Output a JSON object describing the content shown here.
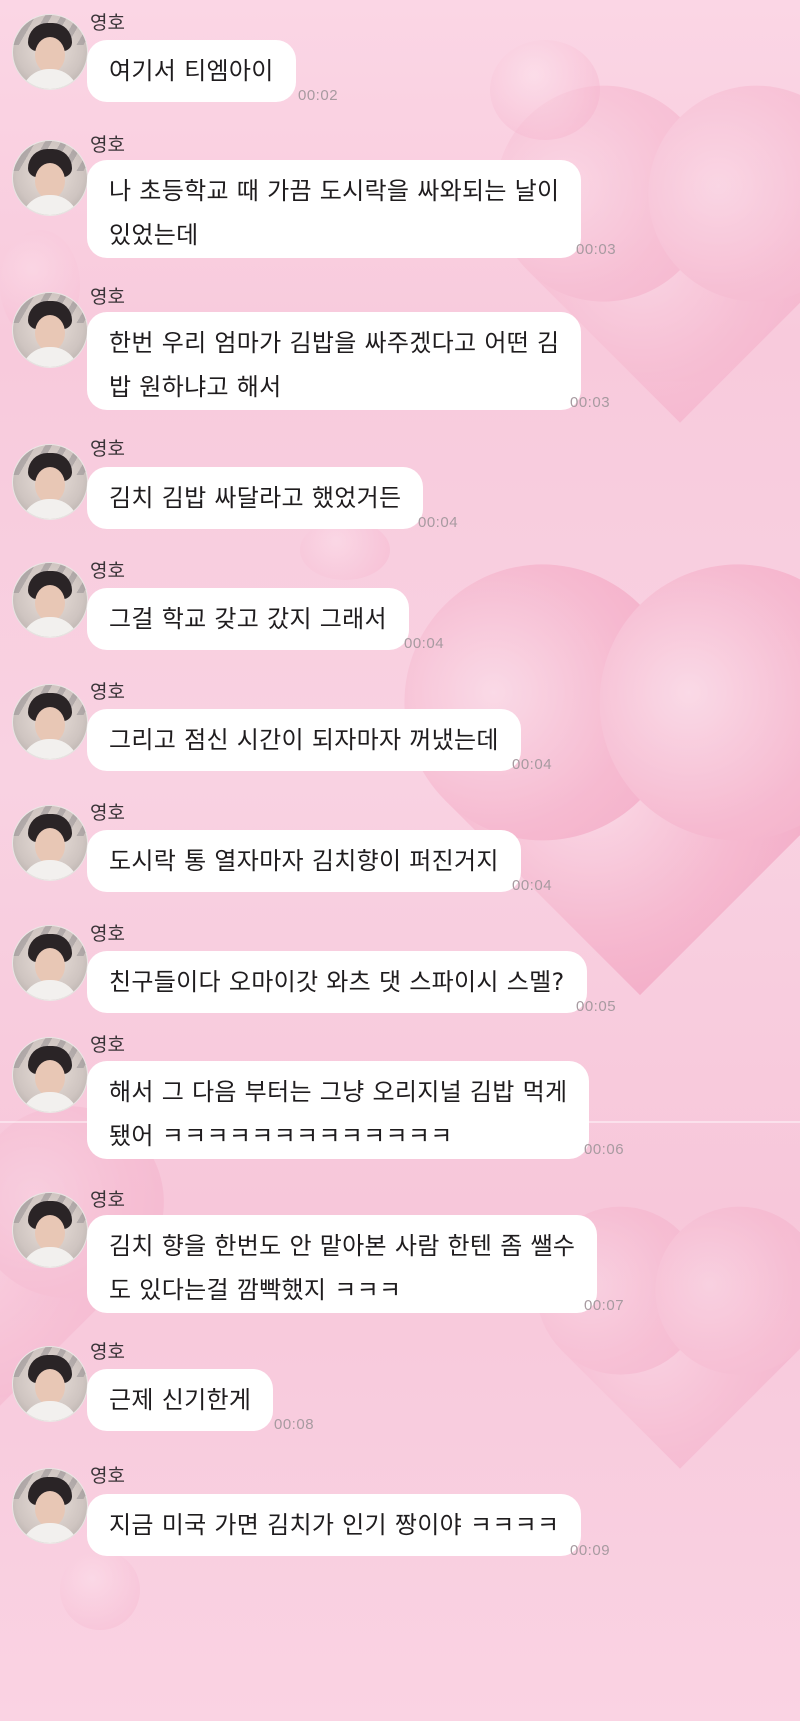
{
  "chat": {
    "messages": [
      {
        "sender": "영호",
        "lines": [
          "여기서 티엠아이"
        ],
        "time": "00:02"
      },
      {
        "sender": "영호",
        "lines": [
          "나 초등학교 때 가끔 도시락을 싸와되는 날이",
          "있었는데"
        ],
        "time": "00:03"
      },
      {
        "sender": "영호",
        "lines": [
          "한번 우리 엄마가 김밥을 싸주겠다고 어떤 김",
          "밥 원하냐고 해서"
        ],
        "time": "00:03"
      },
      {
        "sender": "영호",
        "lines": [
          "김치 김밥 싸달라고 했었거든"
        ],
        "time": "00:04"
      },
      {
        "sender": "영호",
        "lines": [
          "그걸 학교 갖고 갔지 그래서"
        ],
        "time": "00:04"
      },
      {
        "sender": "영호",
        "lines": [
          "그리고 점신 시간이 되자마자 꺼냈는데"
        ],
        "time": "00:04"
      },
      {
        "sender": "영호",
        "lines": [
          "도시락 통 열자마자 김치향이 퍼진거지"
        ],
        "time": "00:04"
      },
      {
        "sender": "영호",
        "lines": [
          "친구들이다 오마이갓 와츠 댓 스파이시 스멜?"
        ],
        "time": "00:05"
      },
      {
        "sender": "영호",
        "lines": [
          "해서 그 다음 부터는 그냥 오리지널 김밥 먹게",
          "됐어 ㅋㅋㅋㅋㅋㅋㅋㅋㅋㅋㅋㅋㅋ"
        ],
        "time": "00:06"
      },
      {
        "sender": "영호",
        "lines": [
          "김치 향을 한번도 안 맡아본 사람 한텐 좀 쌜수",
          "도 있다는걸 깜빡했지 ㅋㅋㅋ"
        ],
        "time": "00:07"
      },
      {
        "sender": "영호",
        "lines": [
          "근제 신기한게"
        ],
        "time": "00:08"
      },
      {
        "sender": "영호",
        "lines": [
          "지금 미국 가면 김치가 인기 짱이야 ㅋㅋㅋㅋ"
        ],
        "time": "00:09"
      }
    ]
  }
}
